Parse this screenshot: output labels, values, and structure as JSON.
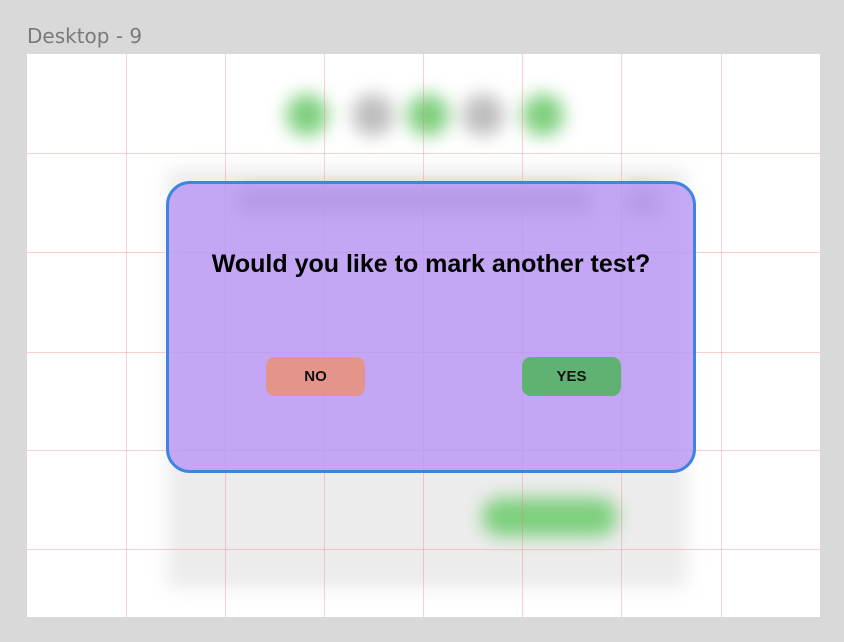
{
  "frame": {
    "label": "Desktop - 9"
  },
  "dialog": {
    "question": "Would you like to mark another test?",
    "no_label": "NO",
    "yes_label": "YES"
  },
  "colors": {
    "dialog_background": "#ba96f5",
    "dialog_border": "#3d86e0",
    "no_button": "#e4948a",
    "yes_button": "#5fb271",
    "grid_line": "#f07878"
  }
}
